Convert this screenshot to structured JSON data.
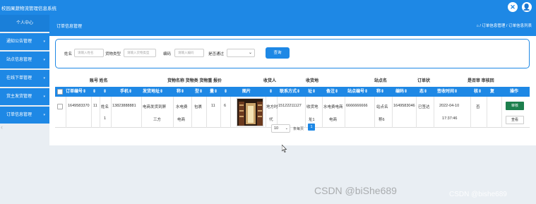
{
  "app": {
    "title": "校园果蔬物流管理信息系统",
    "close_glyph": "✕",
    "user_glyph": "👤"
  },
  "sidebar": {
    "items": [
      {
        "label": "个人中心",
        "caret": ""
      },
      {
        "label": "通知公告管理",
        "caret": "▾"
      },
      {
        "label": "站点信息管理",
        "caret": "▾"
      },
      {
        "label": "在线下单管理",
        "caret": "▾"
      },
      {
        "label": "货主发货管理",
        "caret": "▾"
      },
      {
        "label": "订单信息管理",
        "caret": "▾"
      }
    ],
    "collapse_glyph": "‹"
  },
  "header": {
    "title": "订单信息管理",
    "breadcrumb": "⌂ / 订单信息管理 / 订单信息列表"
  },
  "search": {
    "name_label": "姓名",
    "name_placeholder": "请输入姓名",
    "goods_type_label": "货物类型",
    "goods_type_placeholder": "请输入货物类型",
    "code_label": "编码",
    "code_placeholder": "请输入编码",
    "approved_label": "是否通过",
    "approved_value": "",
    "button_label": "查询"
  },
  "table": {
    "group_headers": [
      "账号 姓名",
      "货物名称 货物类 货物重 报价",
      "收货人",
      "收货地",
      "站点名",
      "订单状",
      "是否审 审核回"
    ],
    "columns": [
      "订单编号⇕",
      "⇕",
      "⇕",
      "手机⇕",
      "发货地址⇕",
      "称⇕",
      "型⇕",
      "量⇕",
      "⇕",
      "图片",
      "⇕",
      "联系方式⇕",
      "址⇕",
      "备注⇕",
      "站点编号⇕",
      "称⇕",
      "编码⇕",
      "态⇕",
      "签收时间⇕",
      "核⇕",
      "复",
      "操作"
    ],
    "rows": [
      {
        "order_no": "1649583370",
        "account": "11",
        "name_1": "姓名",
        "name_2": "1",
        "phone": "13823888881",
        "ship_addr_1": "电商发货到屏",
        "ship_addr_2": "三方",
        "goods_name_1": "水电费",
        "goods_name_2": "电商",
        "goods_type": "包裹",
        "weight": "11",
        "price": "6",
        "receiver_1": "地方时",
        "receiver_2": "代",
        "contact": "15122211127",
        "recv_addr_1": "收货地",
        "recv_addr_2": "址1",
        "note_1": "水电费电商",
        "note_2": "电商",
        "station_no": "6666666666",
        "station_name_1": "站点名",
        "station_name_2": "称6",
        "code": "1649583046",
        "status": "已签达",
        "sign_date": "2022-04-10",
        "sign_time": "17:37:46",
        "approved": "否",
        "reply": "",
        "edit_label": "审核",
        "view_label": "查看"
      }
    ]
  },
  "pagination": {
    "page_size": "10",
    "total_label": "条每页",
    "current_page": "1"
  },
  "watermarks": [
    "CSDN @biShe689",
    "CSDN @bishe689"
  ]
}
